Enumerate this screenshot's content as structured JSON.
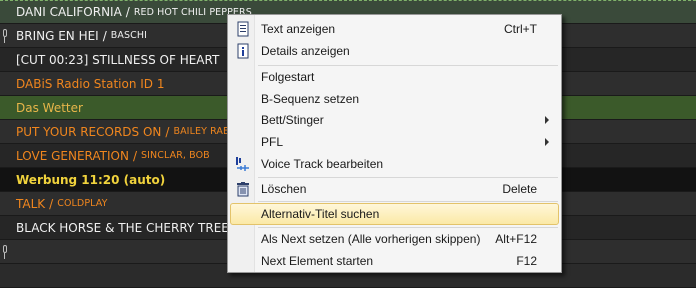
{
  "playlist": {
    "rows": [
      {
        "title": "DANI CALIFORNIA",
        "artist": "RED HOT CHILI PEPPERS",
        "style": "selected-top",
        "color": "c-white",
        "mic": false
      },
      {
        "title": "BRING EN HEI",
        "artist": "BASCHI",
        "style": "dark",
        "color": "c-white",
        "mic": true
      },
      {
        "title": "[CUT 00:23] STILLNESS OF HEART",
        "artist": "",
        "style": "darker",
        "color": "c-white",
        "mic": false
      },
      {
        "title": "DABiS Radio Station ID 1",
        "artist": "",
        "style": "dark",
        "color": "c-orange",
        "mic": false
      },
      {
        "title": "Das Wetter",
        "artist": "",
        "style": "green",
        "color": "c-green",
        "mic": false
      },
      {
        "title": "PUT YOUR RECORDS ON",
        "artist": "BAILEY RAE",
        "style": "dark",
        "color": "c-orange",
        "mic": false
      },
      {
        "title": "LOVE GENERATION",
        "artist": "SINCLAR, BOB",
        "style": "darker",
        "color": "c-orange",
        "mic": false
      },
      {
        "title": "Werbung 11:20 (auto)",
        "artist": "",
        "style": "blackrow",
        "color": "c-yellow",
        "mic": false
      },
      {
        "title": "TALK",
        "artist": "COLDPLAY",
        "style": "dark",
        "color": "c-orange",
        "mic": false
      },
      {
        "title": "BLACK HORSE & THE CHERRY TREE",
        "artist": "",
        "style": "darker",
        "color": "c-white",
        "mic": true
      },
      {
        "title": "",
        "artist": "",
        "style": "dark",
        "color": "c-white",
        "mic": false
      }
    ]
  },
  "context_menu": {
    "items": [
      {
        "label": "Text anzeigen",
        "shortcut": "Ctrl+T",
        "icon": "document-icon"
      },
      {
        "label": "Details anzeigen",
        "shortcut": "",
        "icon": "info-icon"
      },
      {
        "label": "Folgestart",
        "shortcut": ""
      },
      {
        "label": "B-Sequenz setzen",
        "shortcut": ""
      },
      {
        "label": "Bett/Stinger",
        "shortcut": "",
        "submenu": true
      },
      {
        "label": "PFL",
        "shortcut": "",
        "submenu": true
      },
      {
        "label": "Voice Track bearbeiten",
        "shortcut": "",
        "icon": "voicetrack-icon"
      },
      {
        "label": "Löschen",
        "shortcut": "Delete",
        "icon": "trash-icon"
      },
      {
        "label": "Alternativ-Titel suchen",
        "shortcut": "",
        "hover": true
      },
      {
        "label": "Als Next setzen (Alle vorherigen skippen)",
        "shortcut": "Alt+F12"
      },
      {
        "label": "Next Element starten",
        "shortcut": "F12"
      }
    ]
  }
}
